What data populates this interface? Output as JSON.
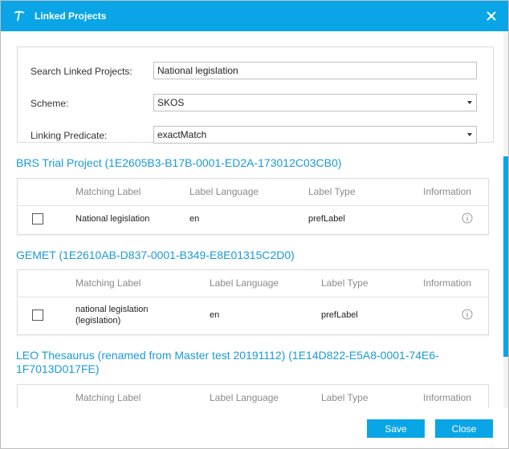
{
  "dialog": {
    "title": "Linked Projects",
    "close_icon": "close-icon",
    "logo_icon": "app-logo-icon",
    "accent_color": "#0aa5e6"
  },
  "form": {
    "search_label": "Search Linked Projects:",
    "search_value": "National legislation",
    "scheme_label": "Scheme:",
    "scheme_value": "SKOS",
    "predicate_label": "Linking Predicate:",
    "predicate_value": "exactMatch"
  },
  "sections": [
    {
      "title": "BRS Trial Project (1E2605B3-B17B-0001-ED2A-173012C03CB0)",
      "headers": [
        "Matching Label",
        "Label Language",
        "Label Type",
        "Information"
      ],
      "rows": [
        {
          "label": "National legislation",
          "language": "en",
          "type": "prefLabel",
          "info_icon": "info-icon"
        }
      ]
    },
    {
      "title": "GEMET (1E2610AB-D837-0001-B349-E8E01315C2D0)",
      "headers": [
        "Matching Label",
        "Label Language",
        "Label Type",
        "Information"
      ],
      "rows": [
        {
          "label": "national legislation\n(legislation)",
          "language": "en",
          "type": "prefLabel",
          "info_icon": "info-icon"
        }
      ]
    },
    {
      "title": "LEO Thesaurus (renamed from Master test 20191112) (1E14D822-E5A8-0001-74E6-1F7013D017FE)",
      "headers": [
        "Matching Label",
        "Label Language",
        "Label Type",
        "Information"
      ],
      "rows": []
    }
  ],
  "footer": {
    "save_label": "Save",
    "close_label": "Close"
  }
}
